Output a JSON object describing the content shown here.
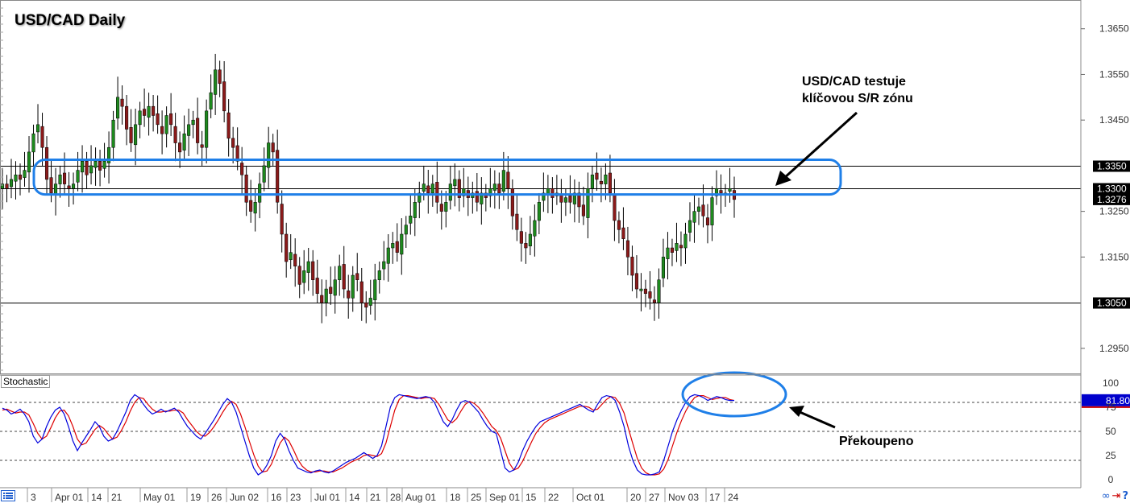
{
  "chart_data": {
    "type": "candlestick",
    "title": "USD/CAD Daily",
    "price_axis": {
      "ylim": [
        1.2895,
        1.3713
      ],
      "ticks": [
        "1.3650",
        "1.3550",
        "1.3450",
        "1.3250",
        "1.3150",
        "1.2950"
      ],
      "ticks_values": [
        1.365,
        1.355,
        1.345,
        1.325,
        1.315,
        1.295
      ]
    },
    "horizontal_lines": [
      {
        "label": "1.3350",
        "value": 1.335
      },
      {
        "label": "1.3300",
        "value": 1.33
      },
      {
        "label": "1.3050",
        "value": 1.305
      }
    ],
    "current_price": {
      "label": "1.3276",
      "value": 1.3276
    },
    "x_labels": [
      "3",
      "Apr 01",
      "14",
      "21",
      "May 01",
      "19",
      "26",
      "Jun 02",
      "16",
      "23",
      "Jul 01",
      "14",
      "21",
      "28",
      "Aug 01",
      "18",
      "25",
      "Sep 01",
      "15",
      "22",
      "Oct 01",
      "20",
      "27",
      "Nov 03",
      "17",
      "24"
    ],
    "close_series": [
      1.331,
      1.33,
      1.332,
      1.333,
      1.332,
      1.334,
      1.338,
      1.342,
      1.344,
      1.339,
      1.332,
      1.329,
      1.331,
      1.333,
      1.331,
      1.33,
      1.331,
      1.334,
      1.336,
      1.333,
      1.335,
      1.336,
      1.334,
      1.336,
      1.339,
      1.345,
      1.35,
      1.348,
      1.343,
      1.34,
      1.344,
      1.347,
      1.346,
      1.348,
      1.346,
      1.344,
      1.342,
      1.346,
      1.344,
      1.34,
      1.338,
      1.342,
      1.344,
      1.345,
      1.34,
      1.339,
      1.347,
      1.351,
      1.356,
      1.353,
      1.347,
      1.341,
      1.339,
      1.336,
      1.333,
      1.327,
      1.325,
      1.327,
      1.331,
      1.335,
      1.34,
      1.338,
      1.327,
      1.32,
      1.314,
      1.316,
      1.313,
      1.309,
      1.312,
      1.314,
      1.31,
      1.307,
      1.305,
      1.308,
      1.307,
      1.31,
      1.313,
      1.308,
      1.306,
      1.311,
      1.31,
      1.305,
      1.304,
      1.306,
      1.31,
      1.312,
      1.314,
      1.317,
      1.318,
      1.316,
      1.32,
      1.322,
      1.324,
      1.327,
      1.329,
      1.331,
      1.329,
      1.331,
      1.327,
      1.325,
      1.327,
      1.331,
      1.332,
      1.328,
      1.33,
      1.328,
      1.329,
      1.327,
      1.329,
      1.328,
      1.33,
      1.331,
      1.329,
      1.334,
      1.33,
      1.324,
      1.321,
      1.318,
      1.317,
      1.32,
      1.323,
      1.327,
      1.329,
      1.33,
      1.328,
      1.329,
      1.327,
      1.328,
      1.327,
      1.329,
      1.326,
      1.324,
      1.33,
      1.333,
      1.332,
      1.331,
      1.333,
      1.329,
      1.323,
      1.321,
      1.319,
      1.315,
      1.311,
      1.308,
      1.308,
      1.307,
      1.306,
      1.305,
      1.31,
      1.315,
      1.317,
      1.316,
      1.318,
      1.317,
      1.32,
      1.323,
      1.325,
      1.326,
      1.324,
      1.322,
      1.328,
      1.33,
      1.329,
      1.329,
      1.33,
      1.3276
    ],
    "stochastic": {
      "label": "Stochastic",
      "ylim": [
        0,
        100
      ],
      "ticks": [
        "100",
        "75",
        "50",
        "25",
        "0"
      ],
      "ticks_values": [
        100,
        75,
        50,
        25,
        0
      ],
      "levels": [
        80,
        50,
        20
      ],
      "current_value": "81.80",
      "k_values": [
        74,
        72,
        68,
        70,
        73,
        68,
        60,
        45,
        38,
        42,
        55,
        65,
        72,
        75,
        68,
        55,
        40,
        30,
        38,
        45,
        52,
        60,
        55,
        45,
        40,
        42,
        50,
        60,
        70,
        82,
        88,
        85,
        78,
        72,
        68,
        70,
        73,
        70,
        72,
        74,
        70,
        62,
        55,
        50,
        45,
        42,
        48,
        55,
        62,
        70,
        78,
        84,
        80,
        70,
        55,
        40,
        25,
        12,
        5,
        8,
        15,
        25,
        40,
        48,
        42,
        30,
        20,
        12,
        10,
        8,
        7,
        9,
        10,
        8,
        7,
        9,
        12,
        15,
        18,
        20,
        22,
        25,
        28,
        25,
        22,
        25,
        35,
        55,
        75,
        85,
        88,
        87,
        86,
        85,
        84,
        85,
        86,
        85,
        80,
        70,
        60,
        55,
        62,
        72,
        80,
        82,
        80,
        75,
        70,
        62,
        55,
        50,
        48,
        30,
        12,
        8,
        10,
        18,
        30,
        40,
        48,
        55,
        60,
        62,
        64,
        66,
        68,
        70,
        72,
        74,
        76,
        78,
        75,
        72,
        70,
        78,
        85,
        87,
        86,
        82,
        70,
        55,
        35,
        20,
        10,
        6,
        5,
        5,
        6,
        8,
        20,
        35,
        50,
        62,
        72,
        80,
        86,
        88,
        87,
        85,
        82,
        84,
        86,
        85,
        83,
        82,
        82
      ],
      "d_values": [
        72,
        73,
        71,
        69,
        70,
        70,
        67,
        58,
        48,
        42,
        45,
        54,
        64,
        71,
        72,
        66,
        55,
        42,
        36,
        38,
        45,
        52,
        56,
        53,
        47,
        42,
        44,
        51,
        60,
        71,
        80,
        85,
        84,
        78,
        73,
        70,
        70,
        71,
        71,
        72,
        72,
        69,
        62,
        56,
        50,
        46,
        45,
        49,
        55,
        62,
        70,
        77,
        81,
        78,
        68,
        55,
        40,
        26,
        14,
        8,
        9,
        16,
        27,
        38,
        44,
        40,
        31,
        21,
        14,
        10,
        8,
        8,
        9,
        9,
        8,
        8,
        10,
        12,
        15,
        18,
        20,
        22,
        25,
        26,
        25,
        24,
        27,
        38,
        55,
        72,
        83,
        87,
        87,
        86,
        85,
        84,
        85,
        85,
        84,
        78,
        70,
        62,
        59,
        63,
        71,
        78,
        81,
        79,
        75,
        69,
        62,
        55,
        51,
        43,
        30,
        17,
        10,
        12,
        19,
        29,
        39,
        48,
        54,
        59,
        62,
        64,
        66,
        68,
        70,
        72,
        74,
        76,
        76,
        75,
        72,
        73,
        78,
        83,
        86,
        85,
        79,
        69,
        53,
        37,
        22,
        12,
        7,
        5,
        5,
        6,
        11,
        21,
        35,
        49,
        61,
        71,
        79,
        85,
        87,
        87,
        85,
        83,
        84,
        85,
        85,
        83,
        82
      ]
    },
    "colors": {
      "bull": "#1e8a1e",
      "bear": "#8b1a1a",
      "k_line": "#0000dd",
      "d_line": "#dd0000",
      "zone_outline": "#1f7fe8",
      "price_tag_bg": "#000000",
      "stoch_tag_bg": "#0000cc"
    }
  },
  "annotations": {
    "zone_note_line1": "USD/CAD testuje",
    "zone_note_line2": "klíčovou S/R zónu",
    "stoch_note": "Překoupeno"
  },
  "icons": {
    "top_left": "menu-list-icon",
    "bottom_right": [
      "link-icon",
      "back-arrow-icon",
      "help-question-icon"
    ]
  }
}
